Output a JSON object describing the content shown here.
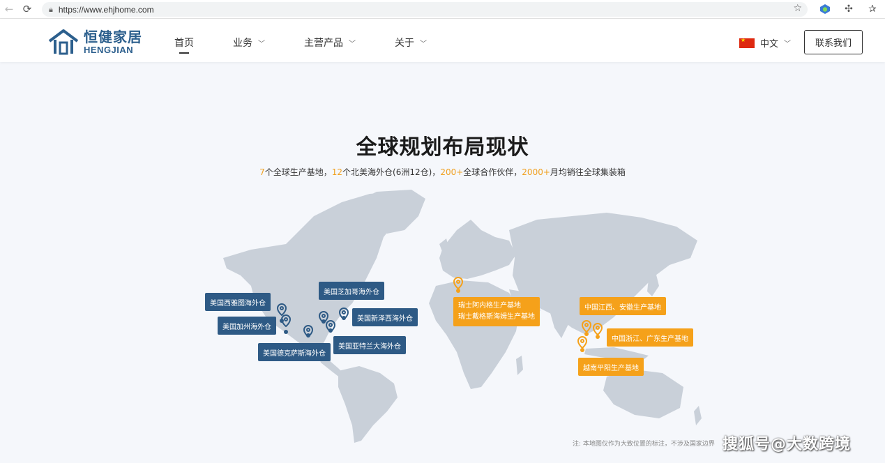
{
  "browser": {
    "url": "https://www.ehjhome.com"
  },
  "header": {
    "logo_cn": "恒健家居",
    "logo_en": "HENGJIAN",
    "nav": [
      {
        "label": "首页"
      },
      {
        "label": "业务"
      },
      {
        "label": "主营产品"
      },
      {
        "label": "关于"
      }
    ],
    "language": "中文",
    "contact_label": "联系我们"
  },
  "section": {
    "title": "全球规划布局现状",
    "stats": [
      {
        "num": "7",
        "text": "个全球生产基地，"
      },
      {
        "num": "12",
        "text": "个北美海外仓(6洲12仓)，"
      },
      {
        "num": "200+",
        "text": "全球合作伙伴，"
      },
      {
        "num": "2000+",
        "text": "月均销往全球集装箱"
      }
    ]
  },
  "map": {
    "labels_us": [
      "美国西雅图海外仓",
      "美国加州海外仓",
      "美国德克萨斯海外仓",
      "美国芝加哥海外仓",
      "美国新泽西海外仓",
      "美国亚特兰大海外仓"
    ],
    "labels_eu": [
      "瑞士阿内格生产基地",
      "瑞士戴格斯海姆生产基地"
    ],
    "labels_asia": [
      "中国江西、安徽生产基地",
      "中国浙江、广东生产基地",
      "越南平阳生产基地"
    ],
    "colors": {
      "warehouse": "#2e5a85",
      "factory": "#f5a11a",
      "land": "#c9d0d9"
    }
  },
  "note": "注: 本地图仅作为大致位置的标注，不涉及国家边界",
  "watermark": "搜狐号@大数跨境"
}
